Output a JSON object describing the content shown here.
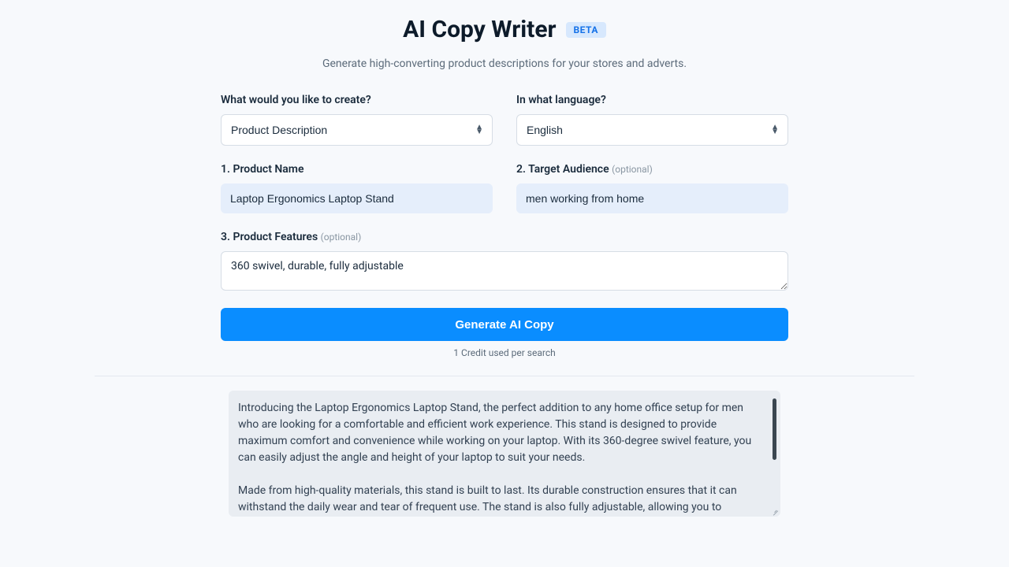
{
  "header": {
    "title": "AI Copy Writer",
    "badge": "BETA",
    "subtitle": "Generate high-converting product descriptions for your stores and adverts."
  },
  "form": {
    "create_label": "What would you like to create?",
    "create_value": "Product Description",
    "language_label": "In what language?",
    "language_value": "English",
    "product_name_label": "1. Product Name",
    "product_name_value": "Laptop Ergonomics Laptop Stand",
    "audience_label": "2. Target Audience",
    "audience_optional": "(optional)",
    "audience_value": "men working from home",
    "features_label": "3. Product Features",
    "features_optional": "(optional)",
    "features_value": "360 swivel, durable, fully adjustable",
    "generate_button": "Generate AI Copy",
    "credit_note": "1 Credit used per search"
  },
  "output": {
    "text": "Introducing the Laptop Ergonomics Laptop Stand, the perfect addition to any home office setup for men who are looking for a comfortable and efficient work experience. This stand is designed to provide maximum comfort and convenience while working on your laptop. With its 360-degree swivel feature, you can easily adjust the angle and height of your laptop to suit your needs.\n\nMade from high-quality materials, this stand is built to last. Its durable construction ensures that it can withstand the daily wear and tear of frequent use. The stand is also fully adjustable, allowing you to customize the height and angle of your laptop to suit your individual needs. This feature is especially important for men"
  }
}
